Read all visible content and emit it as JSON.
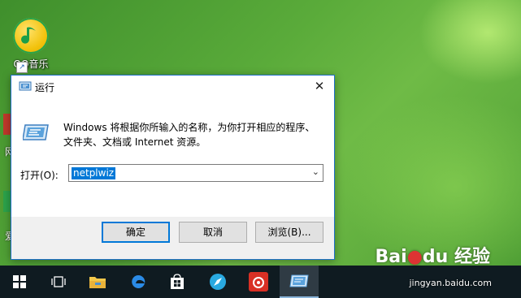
{
  "desktop": {
    "qq_music_label": "QQ音乐",
    "partial_labels": [
      "网",
      "爱"
    ]
  },
  "dialog": {
    "title": "运行",
    "close_glyph": "✕",
    "description_line1": "Windows 将根据你所输入的名称，为你打开相应的程序、",
    "description_line2": "文件夹、文档或 Internet 资源。",
    "open_label": "打开(O):",
    "open_value": "netplwiz",
    "ok_label": "确定",
    "cancel_label": "取消",
    "browse_label": "浏览(B)..."
  },
  "taskbar": {
    "items": [
      "start-icon",
      "task-view-icon",
      "file-explorer-icon",
      "edge-icon",
      "store-icon",
      "browser-icon",
      "netease-music-icon",
      "run-icon"
    ],
    "active": "run-icon"
  },
  "watermark": {
    "logo_text": "Bai",
    "logo_text2": "du",
    "logo_cn": "经验",
    "url": "jingyan.baidu.com"
  },
  "colors": {
    "accent": "#0078d7",
    "taskbar": "#0f1b21",
    "dialog_border": "#1f6fc9"
  }
}
